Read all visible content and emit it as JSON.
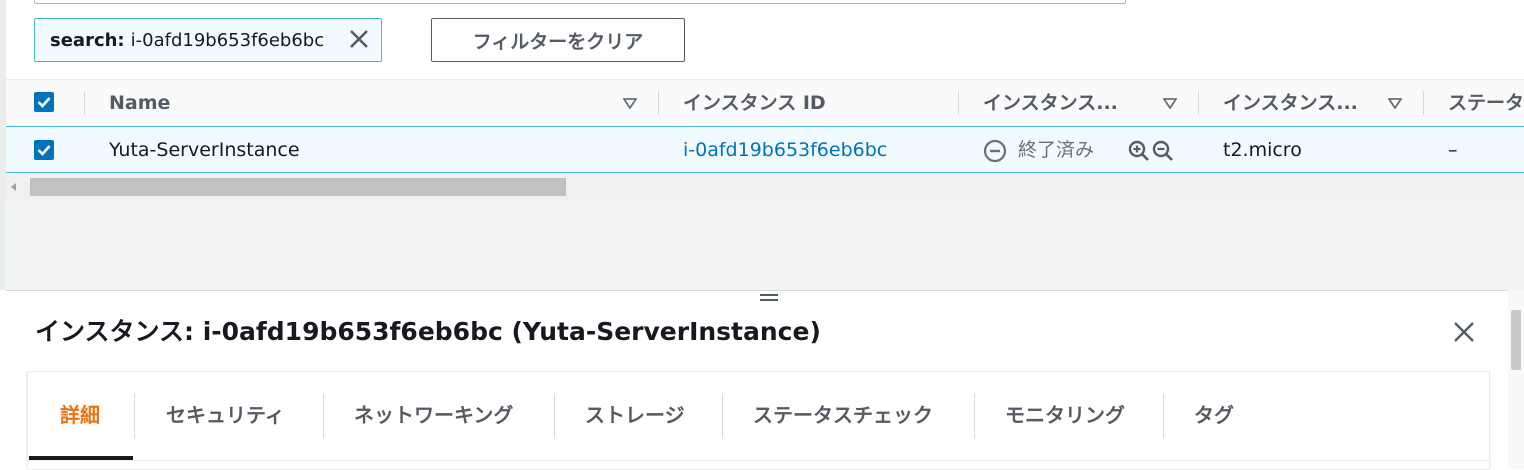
{
  "filter": {
    "token_key": "search:",
    "token_value": "i-0afd19b653f6eb6bc",
    "clear_button": "フィルターをクリア"
  },
  "table": {
    "columns": [
      "Name",
      "インスタンス ID",
      "インスタンス...",
      "インスタンス...",
      "ステータ"
    ],
    "row": {
      "name": "Yuta-ServerInstance",
      "instance_id": "i-0afd19b653f6eb6bc",
      "state": "終了済み",
      "type": "t2.micro",
      "status": "–"
    }
  },
  "detail": {
    "title": "インスタンス: i-0afd19b653f6eb6bc (Yuta-ServerInstance)",
    "tabs": [
      "詳細",
      "セキュリティ",
      "ネットワーキング",
      "ストレージ",
      "ステータスチェック",
      "モニタリング",
      "タグ"
    ],
    "active_tab": "詳細"
  },
  "colors": {
    "accent": "#0073bb",
    "active_tab": "#ec7211",
    "selected_row_bg": "#f1faff",
    "selected_row_border": "#44b9d6"
  }
}
